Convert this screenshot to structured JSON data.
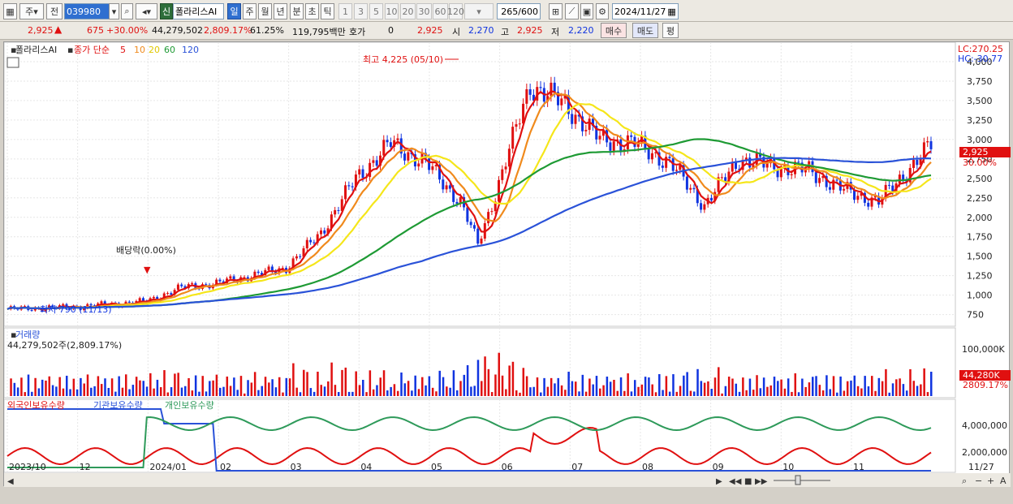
{
  "toolbar": {
    "market": "주",
    "prefix": "전",
    "code": "039980",
    "new_badge": "신",
    "name": "폴라리스AI",
    "periods": [
      "일",
      "주",
      "월",
      "년",
      "분",
      "초",
      "틱"
    ],
    "minutes": [
      "1",
      "3",
      "5",
      "10",
      "20",
      "30",
      "60",
      "120"
    ],
    "count": "265",
    "count_total": "/600",
    "date": "2024/11/27"
  },
  "quote": {
    "price": "2,925",
    "change": "675",
    "change_rate": "+30.00%",
    "volume": "44,279,502",
    "volume_rate": "2,809.17%",
    "turnover_rate": "61.25%",
    "amount": "119,795백만",
    "ask_label": "호가",
    "ask_value": "0",
    "ask_price": "2,925",
    "open_label": "시",
    "open": "2,270",
    "high_label": "고",
    "high": "2,925",
    "low_label": "저",
    "low": "2,220",
    "buy": "매수",
    "sell": "매도",
    "eval": "평"
  },
  "price_panel": {
    "name": "폴라리스AI",
    "ma_title": "종가 단순",
    "ma_periods": [
      "5",
      "10",
      "20",
      "60",
      "120"
    ],
    "lc": "LC:270.25",
    "hc": "HC:-30.77",
    "high_annotation": "최고 4,225 (05/10)",
    "low_annotation": "최저 790 (11/13)",
    "dividend_annotation": "배당락(0.00%)",
    "last_price": "2,925",
    "last_rate": "30.00%",
    "y_ticks": [
      "4,000",
      "3,750",
      "3,500",
      "3,250",
      "3,000",
      "2,750",
      "2,500",
      "2,250",
      "2,000",
      "1,750",
      "1,500",
      "1,250",
      "1,000",
      "750"
    ]
  },
  "volume_panel": {
    "title": "거래량",
    "value": "44,279,502주(2,809.17%)",
    "tick": "100,000K",
    "last": "44,280K",
    "last_rate": "2809.17%"
  },
  "holder_panel": {
    "legend": [
      "외국인보유수량",
      "기관보유수량",
      "개인보유수량"
    ],
    "ticks": [
      "4,000,000",
      "2,000,000"
    ]
  },
  "x_axis": [
    "2023/10",
    "12",
    "2024/01",
    "02",
    "03",
    "04",
    "05",
    "06",
    "07",
    "08",
    "09",
    "10",
    "11",
    "11/27"
  ],
  "colors": {
    "up": "#e01010",
    "down": "#1034e0",
    "ma5": "#e01010",
    "ma10": "#f08a1c",
    "ma20": "#f5e61a",
    "ma60": "#1e9a34",
    "ma120": "#2a52d8",
    "foreign": "#e01010",
    "inst": "#2a52d8",
    "indiv": "#2e9a5a"
  },
  "chart_data": {
    "type": "line",
    "series": [
      {
        "name": "종가",
        "x": [
          0,
          20,
          40,
          50,
          60,
          70,
          80,
          90,
          100,
          110,
          120,
          130,
          135,
          140,
          150,
          160,
          170,
          180,
          190,
          200,
          210,
          220,
          230,
          240,
          250,
          265
        ],
        "values": [
          820,
          850,
          920,
          1100,
          1150,
          1250,
          1350,
          1800,
          2500,
          2950,
          2700,
          2200,
          1650,
          2300,
          3700,
          3450,
          3000,
          2950,
          2700,
          2150,
          2750,
          2650,
          2600,
          2350,
          2200,
          2925
        ]
      }
    ],
    "ylim": [
      600,
      4250
    ]
  }
}
